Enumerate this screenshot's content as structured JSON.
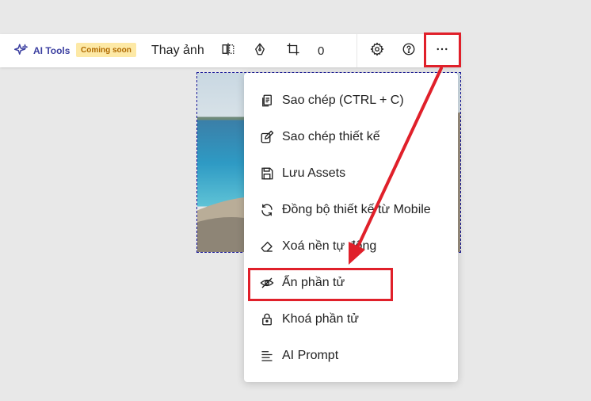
{
  "toolbar": {
    "ai_tools_label": "AI Tools",
    "coming_soon_badge": "Coming soon",
    "replace_image_label": "Thay ảnh",
    "counter_value": "0"
  },
  "menu": {
    "items": [
      {
        "label": "Sao chép (CTRL + C)",
        "icon": "copy-icon"
      },
      {
        "label": "Sao chép thiết kế",
        "icon": "copy-design-icon"
      },
      {
        "label": "Lưu Assets",
        "icon": "save-icon"
      },
      {
        "label": "Đồng bộ thiết kế từ Mobile",
        "icon": "sync-icon"
      },
      {
        "label": "Xoá nền tự động",
        "icon": "eraser-icon"
      },
      {
        "label": "Ẩn phần tử",
        "icon": "eye-off-icon"
      },
      {
        "label": "Khoá phần tử",
        "icon": "lock-icon"
      },
      {
        "label": "AI Prompt",
        "icon": "text-lines-icon"
      }
    ]
  },
  "colors": {
    "annotation_red": "#e0202a",
    "ai_tools_accent": "#3b3fa0",
    "badge_bg": "#fde9a6",
    "selection_border": "#1a1a9a"
  }
}
